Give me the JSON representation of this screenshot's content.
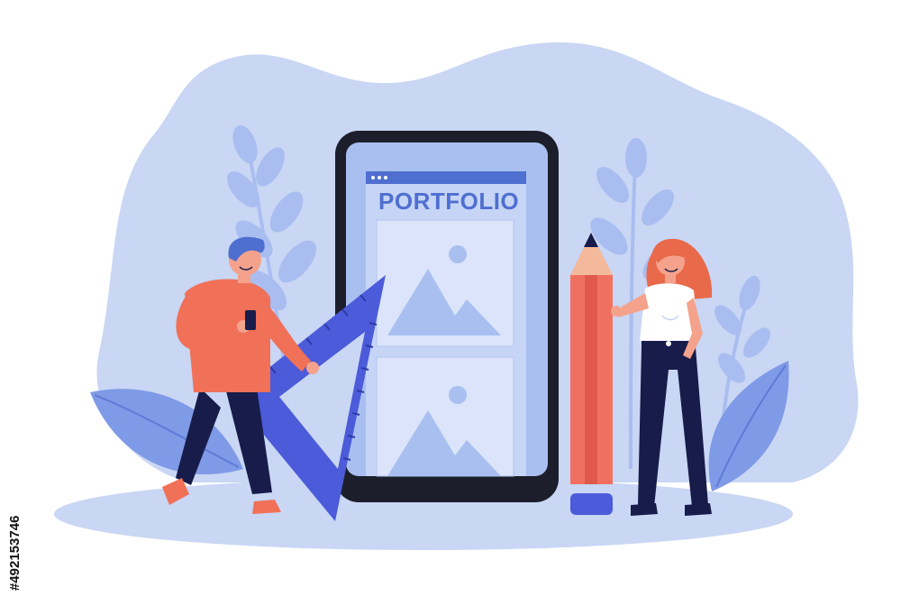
{
  "screen": {
    "title": "PORTFOLIO"
  },
  "watermark": {
    "stock_id": "#492153746"
  },
  "colors": {
    "background_blob": "#c9d6f4",
    "phone_frame": "#1c1f2b",
    "phone_screen": "#a9bff0",
    "card": "#c6d4f6",
    "card_shape": "#9fb4ec",
    "accent_blue": "#4f6fd0",
    "ruler_blue": "#4b5bd9",
    "pencil_red": "#f07060",
    "shirt_orange": "#f07058",
    "pants_navy": "#171c4a",
    "hair_red": "#e86a4a",
    "leaf_blue": "#7f9ae6"
  }
}
